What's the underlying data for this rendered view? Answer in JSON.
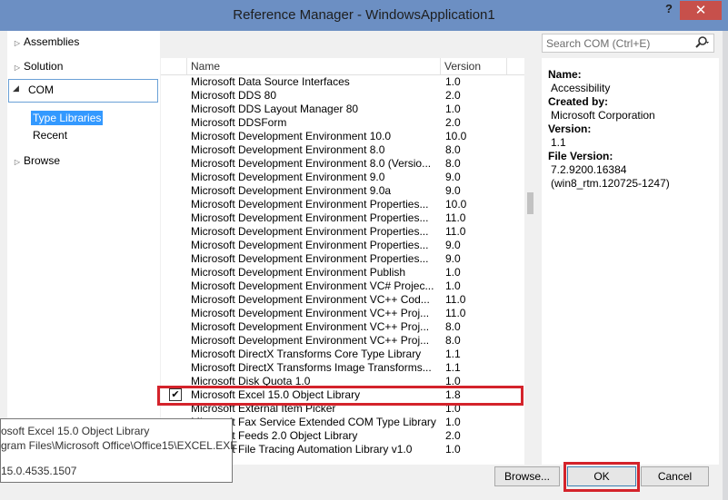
{
  "window": {
    "title": "Reference Manager - WindowsApplication1",
    "help": "?",
    "close": "✕"
  },
  "nav": {
    "assemblies": "Assemblies",
    "solution": "Solution",
    "com": "COM",
    "type_libraries": "Type Libraries",
    "recent": "Recent",
    "browse": "Browse"
  },
  "list": {
    "headers": {
      "name": "Name",
      "version": "Version"
    },
    "rows": [
      {
        "name": "Microsoft Data Source Interfaces",
        "version": "1.0"
      },
      {
        "name": "Microsoft DDS 80",
        "version": "2.0"
      },
      {
        "name": "Microsoft DDS Layout Manager 80",
        "version": "1.0"
      },
      {
        "name": "Microsoft DDSForm",
        "version": "2.0"
      },
      {
        "name": "Microsoft Development Environment 10.0",
        "version": "10.0"
      },
      {
        "name": "Microsoft Development Environment 8.0",
        "version": "8.0"
      },
      {
        "name": "Microsoft Development Environment 8.0 (Versio...",
        "version": "8.0"
      },
      {
        "name": "Microsoft Development Environment 9.0",
        "version": "9.0"
      },
      {
        "name": "Microsoft Development Environment 9.0a",
        "version": "9.0"
      },
      {
        "name": "Microsoft Development Environment Properties...",
        "version": "10.0"
      },
      {
        "name": "Microsoft Development Environment Properties...",
        "version": "11.0"
      },
      {
        "name": "Microsoft Development Environment Properties...",
        "version": "11.0"
      },
      {
        "name": "Microsoft Development Environment Properties...",
        "version": "9.0"
      },
      {
        "name": "Microsoft Development Environment Properties...",
        "version": "9.0"
      },
      {
        "name": "Microsoft Development Environment Publish",
        "version": "1.0"
      },
      {
        "name": "Microsoft Development Environment VC# Projec...",
        "version": "1.0"
      },
      {
        "name": "Microsoft Development Environment VC++ Cod...",
        "version": "11.0"
      },
      {
        "name": "Microsoft Development Environment VC++ Proj...",
        "version": "11.0"
      },
      {
        "name": "Microsoft Development Environment VC++ Proj...",
        "version": "8.0"
      },
      {
        "name": "Microsoft Development Environment VC++ Proj...",
        "version": "8.0"
      },
      {
        "name": "Microsoft DirectX Transforms Core Type Library",
        "version": "1.1"
      },
      {
        "name": "Microsoft DirectX Transforms Image Transforms...",
        "version": "1.1"
      },
      {
        "name": "Microsoft Disk Quota 1.0",
        "version": "1.0"
      },
      {
        "name": "Microsoft Excel 15.0 Object Library",
        "version": "1.8",
        "checked": true
      },
      {
        "name": "Microsoft External Item Picker",
        "version": "1.0"
      },
      {
        "name": "Microsoft Fax Service Extended COM Type Library",
        "version": "1.0"
      },
      {
        "name": "Microsoft Feeds 2.0 Object Library",
        "version": "2.0"
      },
      {
        "name": "Microsoft File Tracing Automation Library v1.0",
        "version": "1.0"
      }
    ]
  },
  "search": {
    "placeholder": "Search COM (Ctrl+E)"
  },
  "details": {
    "name_label": "Name:",
    "name_value": "Accessibility",
    "created_label": "Created by:",
    "created_value": "Microsoft Corporation",
    "version_label": "Version:",
    "version_value": "1.1",
    "file_version_label": "File Version:",
    "file_version_value": "7.2.9200.16384",
    "file_version_build": "(win8_rtm.120725-1247)"
  },
  "tooltip": {
    "line1": "osoft Excel 15.0 Object Library",
    "line2": "gram Files\\Microsoft Office\\Office15\\EXCEL.EXE",
    "line3": "15.0.4535.1507"
  },
  "buttons": {
    "browse": "Browse...",
    "ok": "OK",
    "cancel": "Cancel"
  }
}
